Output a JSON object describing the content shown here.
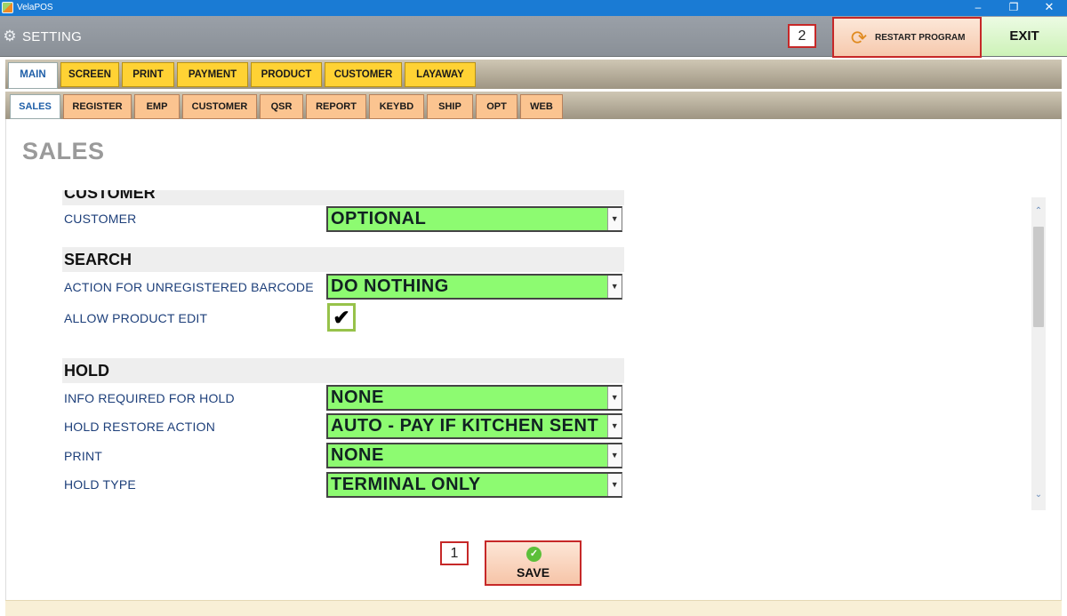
{
  "window": {
    "app_title": "VelaPOS",
    "minimize": "–",
    "maximize": "❐",
    "close": "✕"
  },
  "header": {
    "title": "SETTING",
    "restart_label": "RESTART PROGRAM",
    "exit_label": "EXIT",
    "callout_restart": "2"
  },
  "main_tabs": [
    {
      "label": "MAIN",
      "active": true
    },
    {
      "label": "SCREEN"
    },
    {
      "label": "PRINT"
    },
    {
      "label": "PAYMENT"
    },
    {
      "label": "PRODUCT"
    },
    {
      "label": "CUSTOMER"
    },
    {
      "label": "LAYAWAY"
    }
  ],
  "sub_tabs": [
    {
      "label": "SALES",
      "active": true
    },
    {
      "label": "REGISTER"
    },
    {
      "label": "EMP"
    },
    {
      "label": "CUSTOMER"
    },
    {
      "label": "QSR"
    },
    {
      "label": "REPORT"
    },
    {
      "label": "KEYBD"
    },
    {
      "label": "SHIP"
    },
    {
      "label": "OPT"
    },
    {
      "label": "WEB"
    }
  ],
  "page_title": "SALES",
  "settings": {
    "customer_section": "CUSTOMER",
    "customer_label": "CUSTOMER",
    "customer_value": "OPTIONAL",
    "search_section": "SEARCH",
    "unregistered_label": "ACTION FOR UNREGISTERED BARCODE",
    "unregistered_value": "DO NOTHING",
    "allow_edit_label": "ALLOW PRODUCT EDIT",
    "allow_edit_checked": true,
    "hold_section": "HOLD",
    "info_required_label": "INFO REQUIRED FOR HOLD",
    "info_required_value": "NONE",
    "restore_label": "HOLD RESTORE ACTION",
    "restore_value": "AUTO - PAY IF KITCHEN SENT",
    "print_label": "PRINT",
    "print_value": "NONE",
    "hold_type_label": "HOLD TYPE",
    "hold_type_value": "TERMINAL ONLY"
  },
  "save": {
    "label": "SAVE",
    "callout": "1"
  },
  "icons": {
    "gear": "gear-icon",
    "restart": "refresh-icon",
    "check": "checkmark-icon",
    "save": "check-circle-icon",
    "dropdown": "chevron-down-icon",
    "scroll_up": "chevron-up-icon",
    "scroll_down": "chevron-down-icon"
  },
  "colors": {
    "field_green": "#8dfb71",
    "tab_yellow": "#ffd234",
    "subtab_orange": "#fbc490",
    "highlight_red": "#c62828",
    "title_blue": "#1a7bd4"
  }
}
